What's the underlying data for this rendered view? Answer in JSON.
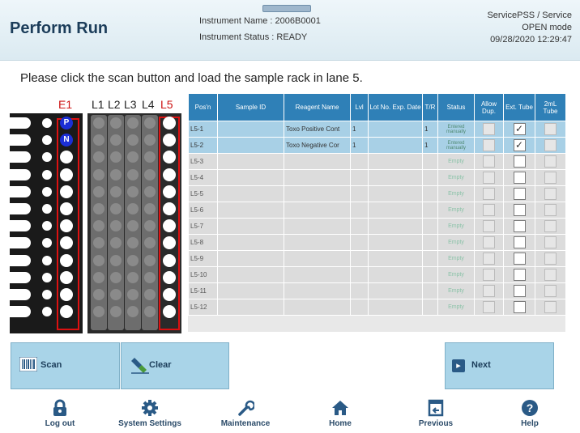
{
  "header": {
    "title": "Perform Run",
    "instrument_name": "Instrument Name : 2006B0001",
    "instrument_status": "Instrument Status : READY",
    "user": "ServicePSS / Service",
    "mode": "OPEN mode",
    "datetime": "09/28/2020 12:29:47"
  },
  "instruction": "Please click the scan button and load the sample rack in lane 5.",
  "rack": {
    "lane_labels": [
      "E1",
      "L1",
      "L2",
      "L3",
      "L4",
      "L5"
    ],
    "e1_tags": [
      "P",
      "N"
    ]
  },
  "table": {
    "headers": [
      "Pos'n",
      "Sample ID",
      "Reagent Name",
      "Lvl",
      "Lot No. Exp. Date",
      "T/R",
      "Status",
      "Allow Dup.",
      "Ext. Tube",
      "2mL Tube"
    ],
    "rows": [
      {
        "pos": "L5-1",
        "sample_id": "",
        "reagent": "Toxo Positive Cont",
        "lvl": "1",
        "lot": "",
        "tr": "1",
        "status": "Entered manually",
        "allow_dup": false,
        "ext_tube": true,
        "tube_2ml": false
      },
      {
        "pos": "L5-2",
        "sample_id": "",
        "reagent": "Toxo Negative Cor",
        "lvl": "1",
        "lot": "",
        "tr": "1",
        "status": "Entered manually",
        "allow_dup": false,
        "ext_tube": true,
        "tube_2ml": false
      },
      {
        "pos": "L5-3",
        "sample_id": "",
        "reagent": "",
        "lvl": "",
        "lot": "",
        "tr": "",
        "status": "Empty",
        "allow_dup": false,
        "ext_tube": false,
        "tube_2ml": false
      },
      {
        "pos": "L5-4",
        "sample_id": "",
        "reagent": "",
        "lvl": "",
        "lot": "",
        "tr": "",
        "status": "Empty",
        "allow_dup": false,
        "ext_tube": false,
        "tube_2ml": false
      },
      {
        "pos": "L5-5",
        "sample_id": "",
        "reagent": "",
        "lvl": "",
        "lot": "",
        "tr": "",
        "status": "Empty",
        "allow_dup": false,
        "ext_tube": false,
        "tube_2ml": false
      },
      {
        "pos": "L5-6",
        "sample_id": "",
        "reagent": "",
        "lvl": "",
        "lot": "",
        "tr": "",
        "status": "Empty",
        "allow_dup": false,
        "ext_tube": false,
        "tube_2ml": false
      },
      {
        "pos": "L5-7",
        "sample_id": "",
        "reagent": "",
        "lvl": "",
        "lot": "",
        "tr": "",
        "status": "Empty",
        "allow_dup": false,
        "ext_tube": false,
        "tube_2ml": false
      },
      {
        "pos": "L5-8",
        "sample_id": "",
        "reagent": "",
        "lvl": "",
        "lot": "",
        "tr": "",
        "status": "Empty",
        "allow_dup": false,
        "ext_tube": false,
        "tube_2ml": false
      },
      {
        "pos": "L5-9",
        "sample_id": "",
        "reagent": "",
        "lvl": "",
        "lot": "",
        "tr": "",
        "status": "Empty",
        "allow_dup": false,
        "ext_tube": false,
        "tube_2ml": false
      },
      {
        "pos": "L5-10",
        "sample_id": "",
        "reagent": "",
        "lvl": "",
        "lot": "",
        "tr": "",
        "status": "Empty",
        "allow_dup": false,
        "ext_tube": false,
        "tube_2ml": false
      },
      {
        "pos": "L5-11",
        "sample_id": "",
        "reagent": "",
        "lvl": "",
        "lot": "",
        "tr": "",
        "status": "Empty",
        "allow_dup": false,
        "ext_tube": false,
        "tube_2ml": false
      },
      {
        "pos": "L5-12",
        "sample_id": "",
        "reagent": "",
        "lvl": "",
        "lot": "",
        "tr": "",
        "status": "Empty",
        "allow_dup": false,
        "ext_tube": false,
        "tube_2ml": false
      }
    ]
  },
  "actions": {
    "scan": "Scan",
    "clear": "Clear",
    "next": "Next"
  },
  "nav": [
    {
      "label": "Log out",
      "icon": "lock-icon"
    },
    {
      "label": "System Settings",
      "icon": "gear-icon"
    },
    {
      "label": "Maintenance",
      "icon": "wrench-icon"
    },
    {
      "label": "Home",
      "icon": "home-icon"
    },
    {
      "label": "Previous",
      "icon": "previous-icon"
    },
    {
      "label": "Help",
      "icon": "help-icon"
    }
  ],
  "colors": {
    "accent": "#2f80b7",
    "button": "#a9d4e8",
    "highlight_row": "#a8d0e6",
    "lane_outline": "#dd1111",
    "nav_icon": "#2a5a86"
  }
}
